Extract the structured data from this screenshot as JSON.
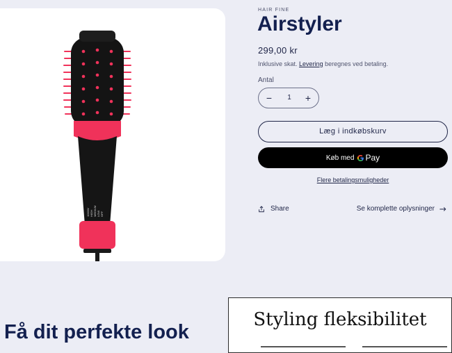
{
  "product": {
    "vendor": "HAIR FINE",
    "title": "Airstyler",
    "price": "299,00 kr",
    "tax_note_prefix": "Inklusive skat.",
    "tax_note_link": "Levering",
    "tax_note_suffix": "beregnes ved betaling."
  },
  "quantity": {
    "label": "Antal",
    "value": "1",
    "minus_icon": "−",
    "plus_icon": "+"
  },
  "buttons": {
    "add_to_cart": "Læg i indkøbskurv",
    "gpay_prefix": "Køb med",
    "gpay_brand": "Pay",
    "more_payment": "Flere betalingsmuligheder"
  },
  "actions": {
    "share": "Share",
    "details": "Se komplette oplysninger"
  },
  "section": {
    "headline": "Få dit perfekte look",
    "feature_title": "Styling fleksibilitet"
  },
  "brush_labels": [
    "1000W",
    "HIGH",
    "MEDIUM",
    "LOW",
    "OFF"
  ],
  "colors": {
    "accent": "#f0325a",
    "text": "#1f2547",
    "heading": "#13204f",
    "background": "#ecedf5"
  }
}
